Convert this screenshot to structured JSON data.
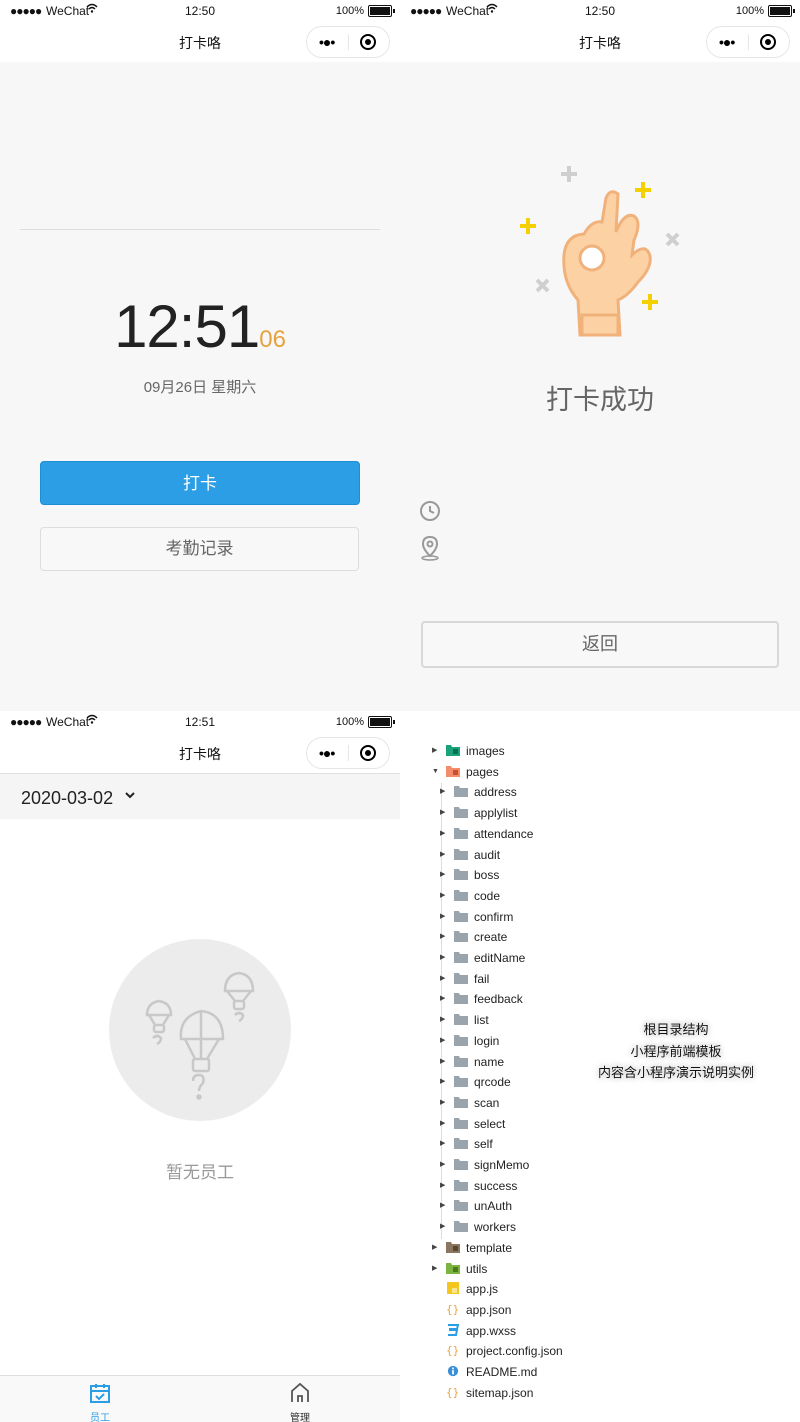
{
  "status_bar": {
    "signal": "●●●●●",
    "carrier": "WeChat",
    "battery": "100%",
    "time_1": "12:50",
    "time_2": "12:50",
    "time_3": "12:51"
  },
  "nav": {
    "title": "打卡咯",
    "more": "•●•"
  },
  "clock_page": {
    "time_hm": "12:51",
    "time_sec": "06",
    "date": "09月26日 星期六",
    "punch_button": "打卡",
    "records_button": "考勤记录",
    "primary_color": "#2b9ee5",
    "seconds_color": "#e6a23c"
  },
  "success_page": {
    "message": "打卡成功",
    "back_button": "返回",
    "icons": [
      "clock-icon",
      "location-pin-icon"
    ]
  },
  "employee_page": {
    "date": "2020-03-02",
    "empty_text": "暂无员工",
    "tabs": [
      {
        "label": "员工",
        "icon": "calendar-check-icon",
        "active": true,
        "color": "#2b9ee5"
      },
      {
        "label": "管理",
        "icon": "home-icon",
        "active": false,
        "color": "#333333"
      }
    ]
  },
  "file_tree": {
    "root": [
      {
        "name": "images",
        "type": "folder-images",
        "expanded": false
      },
      {
        "name": "pages",
        "type": "folder-pages",
        "expanded": true
      }
    ],
    "pages_children": [
      "address",
      "applylist",
      "attendance",
      "audit",
      "boss",
      "code",
      "confirm",
      "create",
      "editName",
      "fail",
      "feedback",
      "list",
      "login",
      "name",
      "qrcode",
      "scan",
      "select",
      "self",
      "signMemo",
      "success",
      "unAuth",
      "workers"
    ],
    "after": [
      {
        "name": "template",
        "type": "folder-template"
      },
      {
        "name": "utils",
        "type": "folder-utils"
      },
      {
        "name": "app.js",
        "type": "js-file"
      },
      {
        "name": "app.json",
        "type": "json-file"
      },
      {
        "name": "app.wxss",
        "type": "css-file"
      },
      {
        "name": "project.config.json",
        "type": "json-file"
      },
      {
        "name": "README.md",
        "type": "info-file"
      },
      {
        "name": "sitemap.json",
        "type": "json-file"
      }
    ],
    "notes": [
      "根目录结构",
      "小程序前端模板",
      "内容含小程序演示说明实例"
    ]
  }
}
